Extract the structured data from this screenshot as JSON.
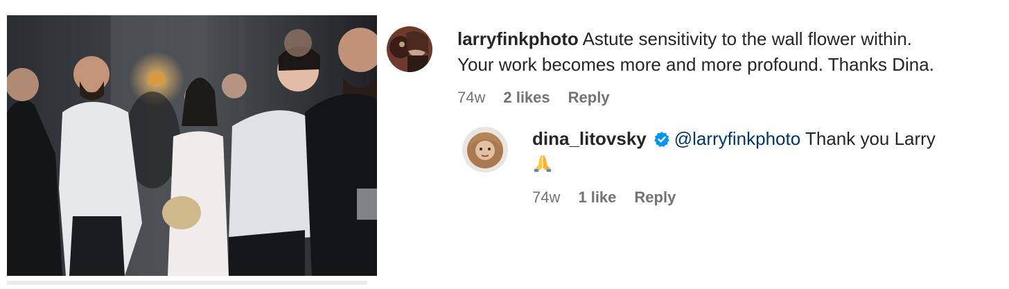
{
  "post": {
    "photo": {
      "description_icon": "photo-image"
    }
  },
  "comments": [
    {
      "username": "larryfinkphoto",
      "text_line1": " Astute sensitivity to the wall flower within.",
      "text_line2": "Your work becomes more and more profound. Thanks Dina.",
      "time": "74w",
      "likes": "2 likes",
      "reply": "Reply"
    },
    {
      "username": "dina_litovsky",
      "verified": true,
      "mention": "@larryfinkphoto",
      "text": " Thank you Larry",
      "emoji": "folded-hands",
      "time": "74w",
      "likes": "1 like",
      "reply": "Reply"
    }
  ],
  "colors": {
    "text": "#262626",
    "meta": "#737373",
    "mention": "#00376b",
    "verified": "#0095f6"
  }
}
